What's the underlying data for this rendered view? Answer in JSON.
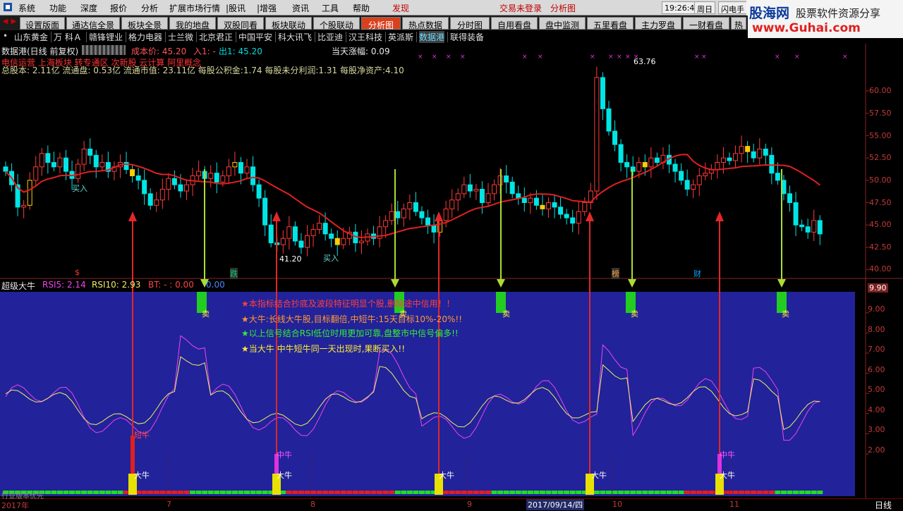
{
  "menu": [
    "系统",
    "功能",
    "深度",
    "报价",
    "分析",
    "扩展市场行情",
    "|股讯",
    "|增强",
    "资讯",
    "工具",
    "帮助",
    "发现"
  ],
  "trade_login": "交易未登录",
  "trade_view": "分析图",
  "clock": "19:26:47",
  "weekday": "周日",
  "flash": "闪电手",
  "banner": {
    "brand": "股海网",
    "tagline": "股票软件资源分享",
    "url": "www.Guhai.com"
  },
  "tabs": [
    "设置版面",
    "通达信全景",
    "板块全景",
    "我的地盘",
    "双股同看",
    "板块联动",
    "个股联动",
    "分析图",
    "热点数据",
    "分时图",
    "自用看盘",
    "盘中监测",
    "五里看盘",
    "主力罗盘",
    "一财看盘",
    "热"
  ],
  "active_tab": "分析图",
  "stocks": [
    "山东黄金",
    "万 科Ａ",
    "赣锋锂业",
    "格力电器",
    "士兰微",
    "北京君正",
    "中国平安",
    "科大讯飞",
    "比亚迪",
    "汉王科技",
    "英派斯",
    "数据港",
    "联得装备"
  ],
  "selected_stock": "数据港",
  "header": {
    "title": "数据港(日线 前复权)",
    "cost_label": "成本价: 45.20",
    "in_label": "入1: -",
    "out_label": "出1: 45.20",
    "day_change": "当天涨幅: 0.09",
    "sector_line": "电信运营  上海板块  转专通区  次新股  云计算  阿里概念",
    "fundamentals": "总股本: 2.11亿 流通盘: 0.53亿 流通市值: 23.11亿 每股公积金:1.74 每股未分利润:1.31 每股净资产:4.10"
  },
  "price_axis": [
    "60.00",
    "57.50",
    "55.00",
    "52.50",
    "50.00",
    "47.50",
    "45.00",
    "42.50",
    "40.00"
  ],
  "price_labels": {
    "high": "63.76",
    "low": "41.20",
    "buy": "买入"
  },
  "event_markers": [
    {
      "text": "$",
      "color": "#ff3333"
    },
    {
      "text": "跌",
      "color": "#00cc66"
    },
    {
      "text": "榜",
      "color": "#ff9933"
    },
    {
      "text": "财",
      "color": "#00aaff"
    }
  ],
  "indicator": {
    "name": "超级大牛",
    "rsi5": "RSI5: 2.14",
    "rsi10": "RSI10: 2.93",
    "bt": "BT: - : 0.00",
    "bt2": "0.00",
    "axis": [
      "9.00",
      "8.00",
      "7.00",
      "6.00",
      "5.00",
      "4.00",
      "3.00",
      "2.00"
    ],
    "axis_top": "9.90",
    "notes": [
      {
        "icon": "★",
        "text": "本指标结合抄底及波段特征明显个股,删除途中信用！！",
        "color": "#ff4040"
      },
      {
        "icon": "★",
        "text": "大牛:长线大牛股,目标翻倍,中短牛:15天目标10%-20%!!",
        "color": "#ff9933"
      },
      {
        "icon": "★",
        "text": "以上信号结合RSI低位时用更加可靠,盘整市中信号偏多!!",
        "color": "#33ee33"
      },
      {
        "icon": "★",
        "text": "当大牛 中牛短牛同一天出现时,果断买入!!",
        "color": "#ffee33"
      }
    ],
    "labels": {
      "sell": "卖",
      "big_bull": "大牛",
      "mid_bull": "中牛",
      "short_bull": "短牛"
    }
  },
  "timeline": {
    "left": "2017年",
    "months": [
      "7",
      "8",
      "9",
      "10",
      "11"
    ],
    "cursor_date": "2017/09/14/四",
    "period": "日线",
    "status": "行业版本优先"
  },
  "colors": {
    "up": "#ff3b3b",
    "down": "#00e5e5",
    "ma": "#e02020",
    "panel": "#22229a",
    "rsi5": "#ee44ee",
    "rsi10": "#eeee66"
  }
}
